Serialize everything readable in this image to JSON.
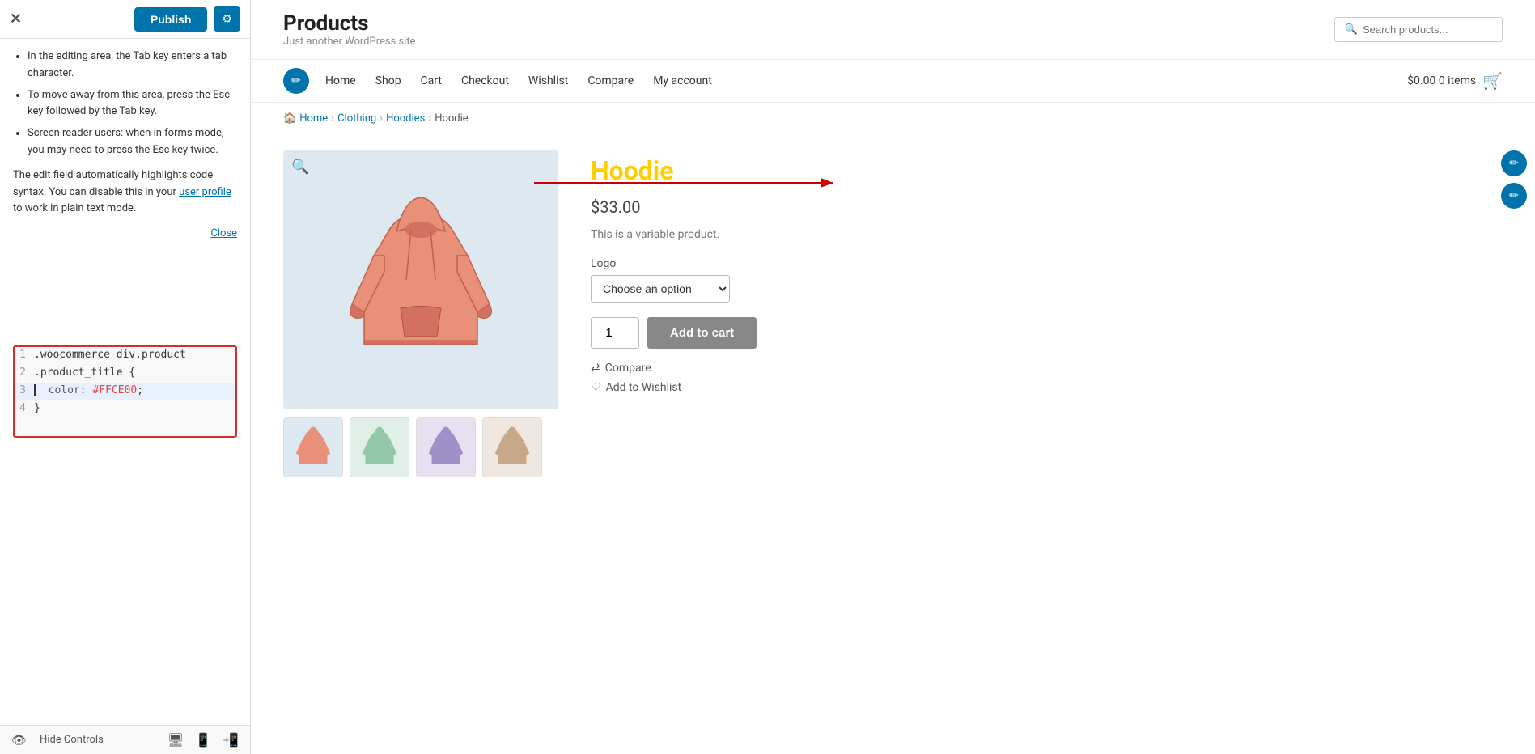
{
  "topbar": {
    "close_label": "✕",
    "publish_label": "Publish",
    "gear_label": "⚙"
  },
  "left_panel": {
    "instructions": [
      "In the editing area, the Tab key enters a tab character.",
      "To move away from this area, press the Esc key followed by the Tab key.",
      "Screen reader users: when in forms mode, you may need to press the Esc key twice."
    ],
    "description": "The edit field automatically highlights code syntax. You can disable this in your",
    "user_profile_link": "user profile",
    "plain_text": " to work in plain text mode.",
    "close_link": "Close",
    "code_lines": [
      {
        "num": "1",
        "content": ".woocommerce div.product"
      },
      {
        "num": "2",
        "content": ".product_title {"
      },
      {
        "num": "3",
        "content": "  color: #FFCE00;"
      },
      {
        "num": "4",
        "content": "}"
      }
    ]
  },
  "bottom_bar": {
    "hide_controls_label": "Hide Controls"
  },
  "site": {
    "title": "Products",
    "tagline": "Just another WordPress site",
    "search_placeholder": "Search products..."
  },
  "nav": {
    "items": [
      "Home",
      "Shop",
      "Cart",
      "Checkout",
      "Wishlist",
      "Compare",
      "My account"
    ],
    "cart_amount": "$0.00",
    "cart_items": "0 items"
  },
  "breadcrumb": {
    "items": [
      "Home",
      "Clothing",
      "Hoodies",
      "Hoodie"
    ],
    "separators": [
      "›",
      "›",
      "›"
    ]
  },
  "product": {
    "title": "Hoodie",
    "price": "$33.00",
    "description": "This is a variable product.",
    "variation_label": "Logo",
    "variation_placeholder": "Choose an option",
    "qty_value": "1",
    "add_to_cart_label": "Add to cart",
    "compare_label": "Compare",
    "wishlist_label": "Add to Wishlist"
  },
  "thumbnails": [
    {
      "id": "thumb-1",
      "bg": "#dde8f0",
      "color": "#e08070"
    },
    {
      "id": "thumb-2",
      "bg": "#e0f0e8",
      "color": "#70a090"
    },
    {
      "id": "thumb-3",
      "bg": "#e8e0f0",
      "color": "#a090c0"
    },
    {
      "id": "thumb-4",
      "bg": "#f0e8e0",
      "color": "#b09070"
    }
  ]
}
